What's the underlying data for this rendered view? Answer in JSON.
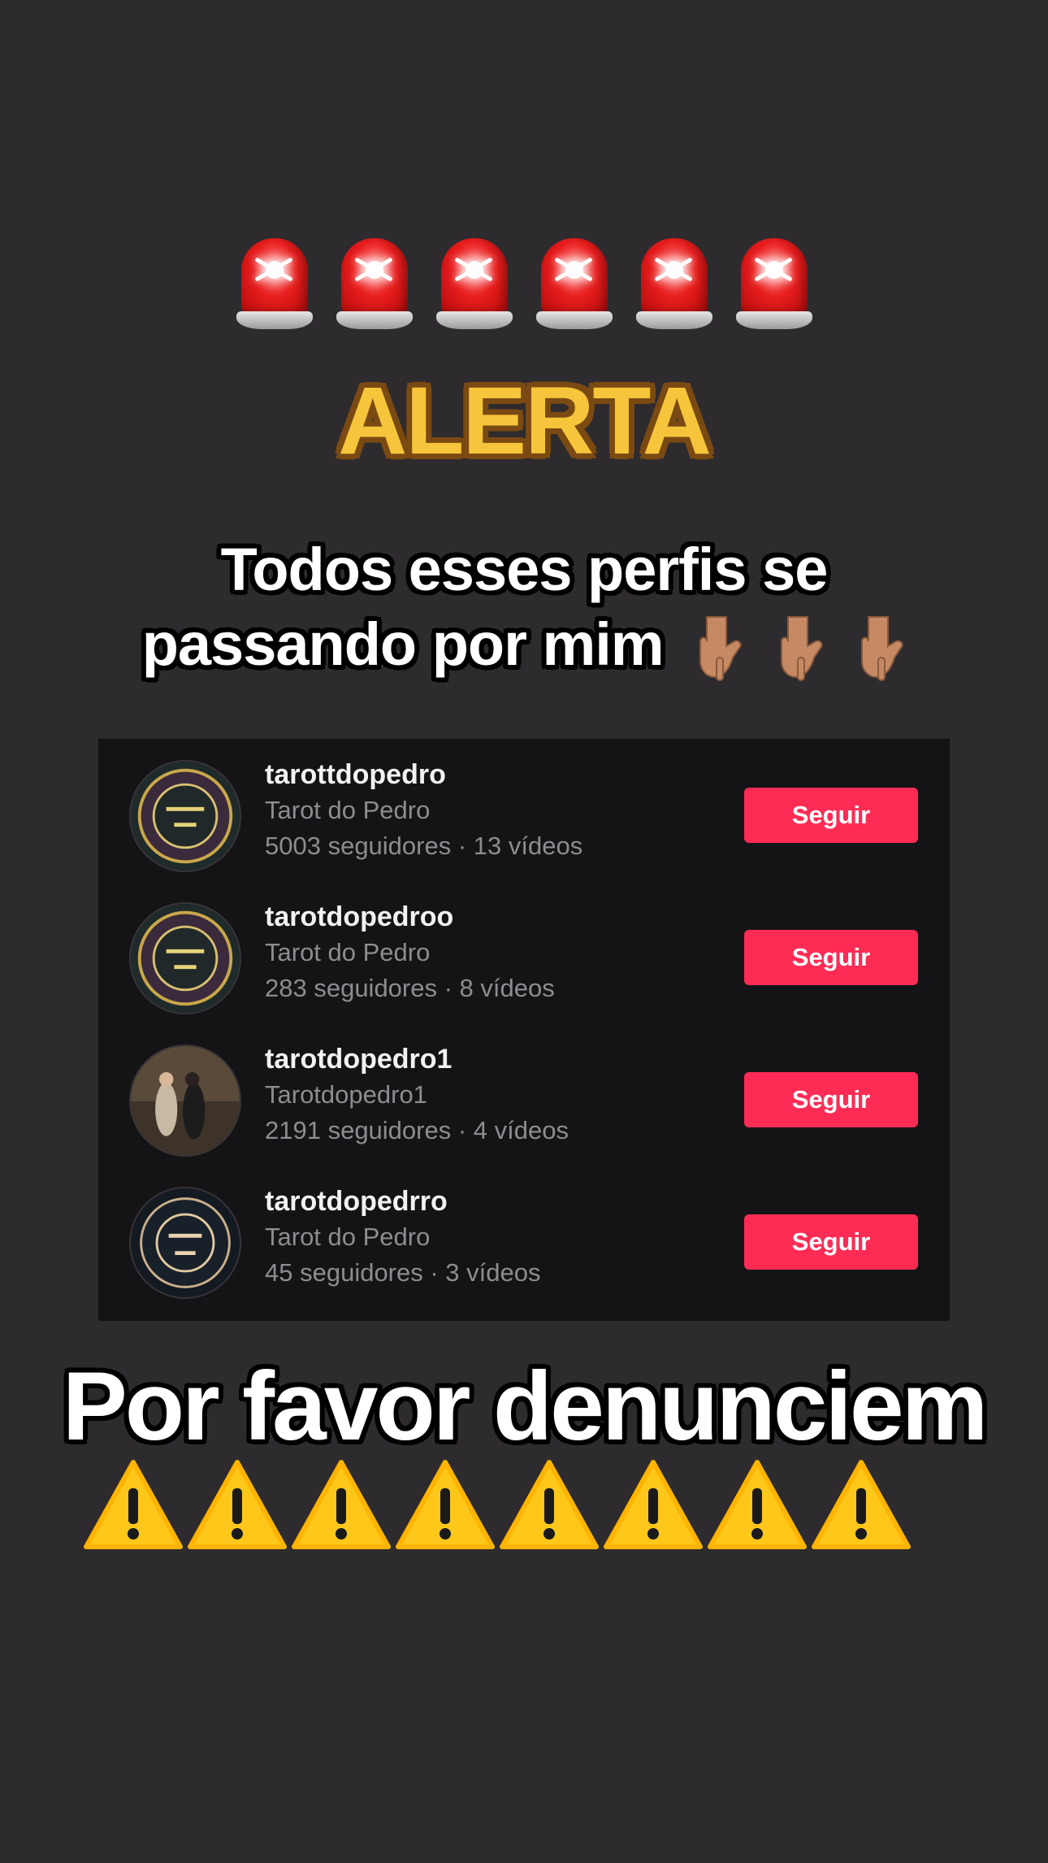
{
  "header": {
    "siren_icons": [
      "police-light-icon",
      "police-light-icon",
      "police-light-icon",
      "police-light-icon",
      "police-light-icon",
      "police-light-icon"
    ],
    "alert_title": "ALERTA"
  },
  "caption_top": {
    "line1": "Todos esses perfis se",
    "line2": "passando por mim",
    "pointer_icons": [
      "backhand-index-pointing-down-icon",
      "backhand-index-pointing-down-icon",
      "backhand-index-pointing-down-icon"
    ]
  },
  "profiles": [
    {
      "username": "tarottdopedro",
      "nickname": "Tarot do Pedro",
      "stats": "5003 seguidores · 13 vídeos",
      "follow_label": "Seguir"
    },
    {
      "username": "tarotdopedroo",
      "nickname": "Tarot do Pedro",
      "stats": "283 seguidores · 8 vídeos",
      "follow_label": "Seguir"
    },
    {
      "username": "tarotdopedro1",
      "nickname": "Tarotdopedro1",
      "stats": "2191 seguidores · 4 vídeos",
      "follow_label": "Seguir"
    },
    {
      "username": "tarotdopedrro",
      "nickname": "Tarot do Pedro",
      "stats": "45 seguidores · 3 vídeos",
      "follow_label": "Seguir"
    }
  ],
  "caption_bottom": {
    "text": "Por favor denunciem",
    "warning_icons": [
      "warning-icon",
      "warning-icon",
      "warning-icon",
      "warning-icon",
      "warning-icon",
      "warning-icon",
      "warning-icon",
      "warning-icon"
    ]
  },
  "colors": {
    "background": "#2d2b2e",
    "panel": "#141315",
    "follow_button": "#fe2c55",
    "alert_text": "#f6c53b",
    "alert_outline": "#7a4a12"
  }
}
